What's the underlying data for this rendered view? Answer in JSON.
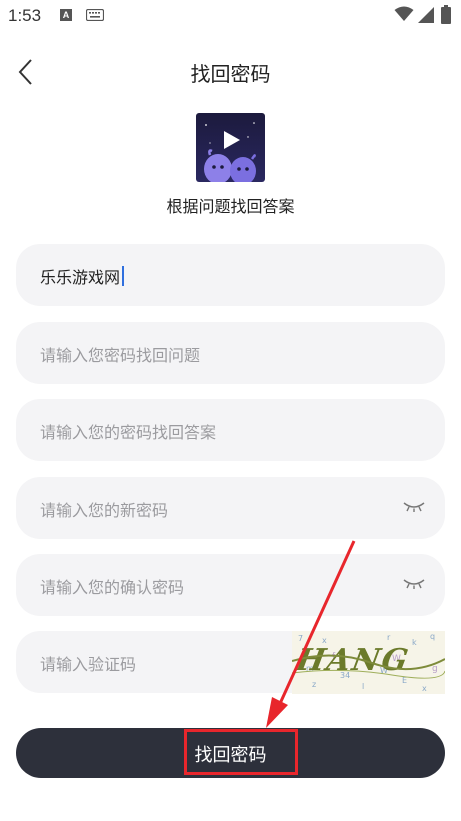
{
  "status_bar": {
    "time": "1:53",
    "notif_letter": "A"
  },
  "header": {
    "title": "找回密码"
  },
  "subtitle": "根据问题找回答案",
  "form": {
    "username_value": "乐乐游戏网",
    "question_placeholder": "请输入您密码找回问题",
    "answer_placeholder": "请输入您的密码找回答案",
    "new_password_placeholder": "请输入您的新密码",
    "confirm_password_placeholder": "请输入您的确认密码",
    "captcha_placeholder": "请输入验证码",
    "captcha_text": "HANG",
    "submit_label": "找回密码"
  },
  "icons": [
    "back-chevron-icon",
    "eye-closed-icon",
    "wifi-icon",
    "signal-icon",
    "battery-icon",
    "keyboard-icon"
  ],
  "annotation_color": "#e8262c"
}
